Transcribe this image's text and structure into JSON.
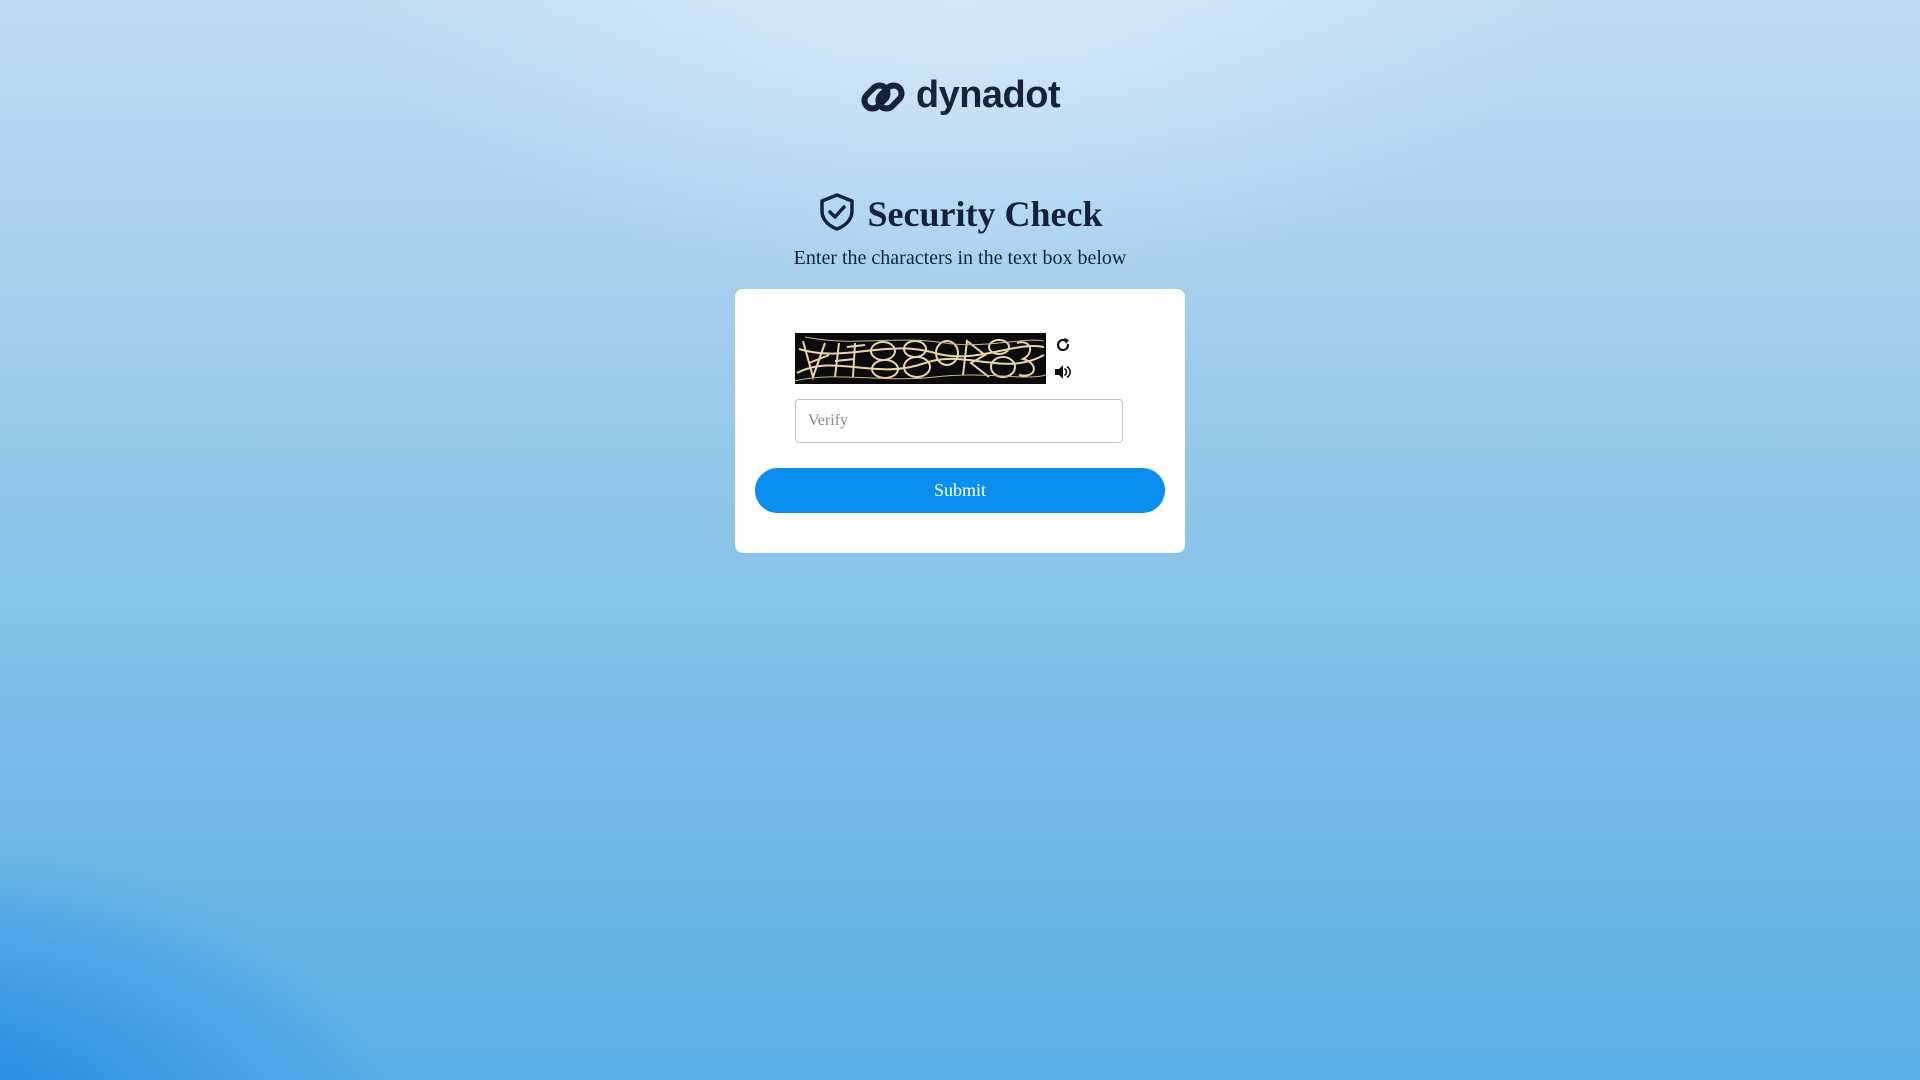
{
  "brand": {
    "name": "dynadot",
    "logo_icon": "chain-link-logo",
    "text_color": "#15213d"
  },
  "security_check": {
    "shield_icon": "shield-check-icon",
    "title": "Security Check",
    "subtitle": "Enter the characters in the text box below"
  },
  "captcha": {
    "image_icon": "captcha-image",
    "refresh_icon": "refresh-icon",
    "audio_icon": "speaker-icon"
  },
  "form": {
    "verify_placeholder": "Verify",
    "verify_value": "",
    "submit_label": "Submit",
    "accent_color": "#0a8ff0"
  }
}
